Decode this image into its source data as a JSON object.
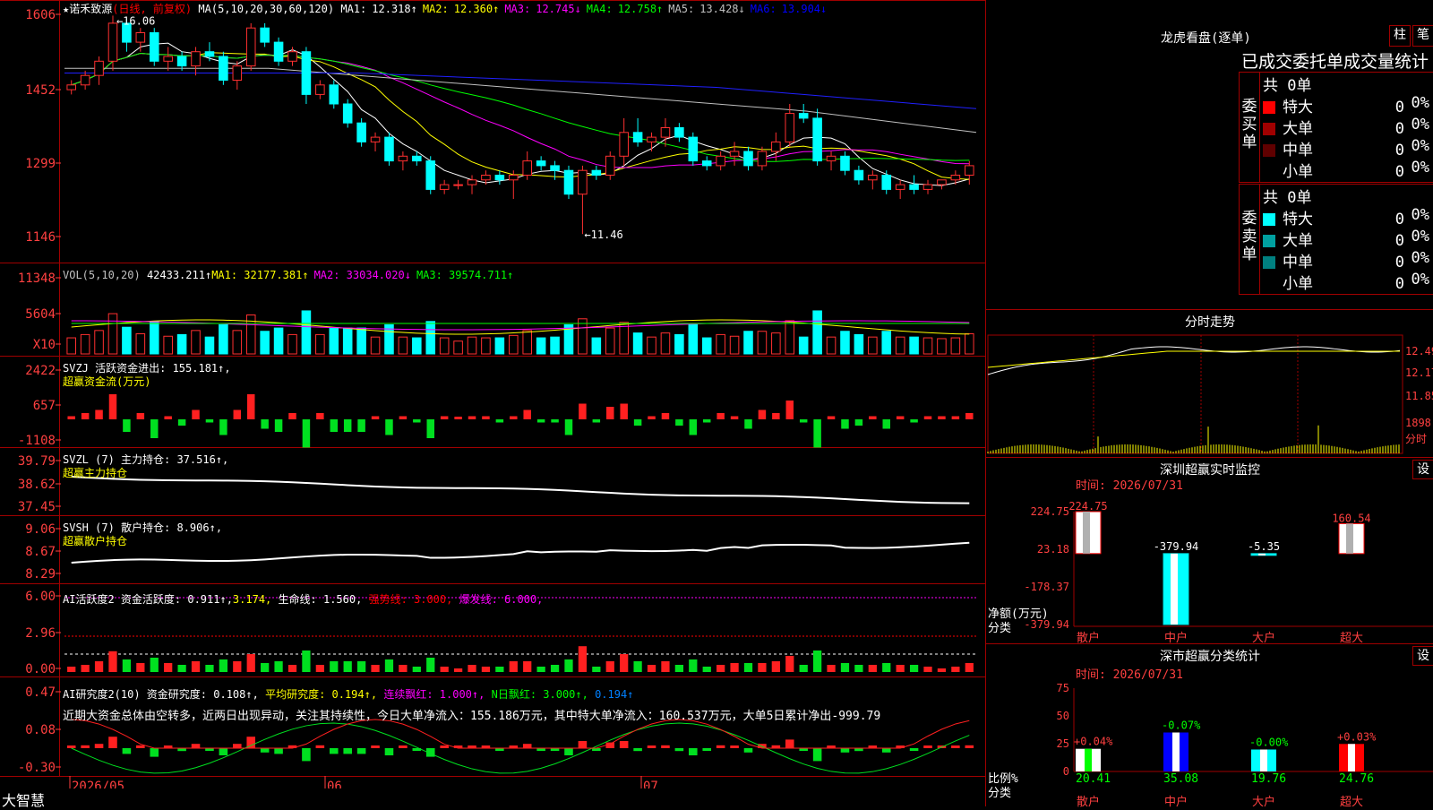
{
  "stock": {
    "star": "★",
    "name": "诺禾致源",
    "mode": "(日线, 前复权)"
  },
  "ma_header": {
    "label": "MA(5,10,20,30,60,120)",
    "items": [
      {
        "name": "MA1:",
        "value": "12.318↑",
        "color": "#ffffff"
      },
      {
        "name": "MA2:",
        "value": "12.360↑",
        "color": "#ffff00"
      },
      {
        "name": "MA3:",
        "value": "12.745↓",
        "color": "#ff00ff"
      },
      {
        "name": "MA4:",
        "value": "12.758↑",
        "color": "#00ff00"
      },
      {
        "name": "MA5:",
        "value": "13.428↓",
        "color": "#c0c0c0"
      },
      {
        "name": "MA6:",
        "value": "13.904↓",
        "color": "#0000ff"
      }
    ]
  },
  "vol_header": {
    "label": "VOL(5,10,20)",
    "value": "42433.211↑",
    "items": [
      {
        "text": "MA1: 32177.381↑",
        "color": "#ffff00"
      },
      {
        "text": "MA2: 33034.020↓",
        "color": "#ff00ff"
      },
      {
        "text": "MA3: 39574.711↑",
        "color": "#00ff00"
      }
    ]
  },
  "svzj": {
    "line1": "SVZJ  活跃资金进出: 155.181↑,",
    "line2": "超赢资金流(万元)"
  },
  "svzl": {
    "line1": "SVZL (7) 主力持仓: 37.516↑,",
    "line2": "超赢主力持仓"
  },
  "svsh": {
    "line1": "SVSH (7) 散户持仓: 8.906↑,",
    "line2": "超赢散户持仓"
  },
  "ai1": {
    "label": "AI活跃度2 资金活跃度: 0.911↑,",
    "v2": "3.174,",
    "v3": "生命线: 1.560,",
    "v4": "强势线: 3.000,",
    "v5": "爆发线: 6.000,"
  },
  "ai2": {
    "label": "AI研究度2(10) 资金研究度: 0.108↑,",
    "v2": "平均研究度: 0.194↑,",
    "v3": "连续飘红: 1.000↑,",
    "v4": "N日飘红: 3.000↑,",
    "v5": "0.194↑",
    "comment": "近期大资金总体由空转多，近两日出现异动，关注其持续性，今日大单净流入：155.186万元，其中特大单净流入：160.537万元，大单5日累计净出-999.79"
  },
  "axes": {
    "price": [
      "1606",
      "1452",
      "1299",
      "1146"
    ],
    "vol": [
      "11348",
      "5604",
      "X10"
    ],
    "svzj": [
      "2422",
      "657",
      "-1108"
    ],
    "svzl": [
      "39.79",
      "38.62",
      "37.45"
    ],
    "svsh": [
      "9.06",
      "8.67",
      "8.29"
    ],
    "ai1": [
      "6.00",
      "2.96",
      "0.00"
    ],
    "ai2": [
      "0.47",
      "0.08",
      "-0.30"
    ],
    "dates": [
      "2026/05",
      "06",
      "07"
    ]
  },
  "annotations": {
    "high": "←16.06",
    "low": "←11.46"
  },
  "brand": "大智慧",
  "right": {
    "title": "龙虎看盘(逐单)",
    "btn1": "柱",
    "btn2": "笔",
    "subtitle": "已成交委托单成交量统计",
    "buy": {
      "side": "委买单",
      "total": "共 0单",
      "rows": [
        {
          "label": "特大",
          "count": "0",
          "pct": "0%",
          "color": "#ff0000"
        },
        {
          "label": "大单",
          "count": "0",
          "pct": "0%",
          "color": "#a00000"
        },
        {
          "label": "中单",
          "count": "0",
          "pct": "0%",
          "color": "#600000"
        },
        {
          "label": "小单",
          "count": "0",
          "pct": "0%",
          "color": "#000000"
        }
      ]
    },
    "sell": {
      "side": "委卖单",
      "total": "共 0单",
      "rows": [
        {
          "label": "特大",
          "count": "0",
          "pct": "0%",
          "color": "#00ffff"
        },
        {
          "label": "大单",
          "count": "0",
          "pct": "0%",
          "color": "#00a0a0"
        },
        {
          "label": "中单",
          "count": "0",
          "pct": "0%",
          "color": "#008080"
        },
        {
          "label": "小单",
          "count": "0",
          "pct": "0%",
          "color": "#000000"
        }
      ]
    },
    "intraday": {
      "title": "分时走势",
      "axis": [
        "12.49",
        "12.17",
        "11.85",
        "1898",
        "分时"
      ]
    },
    "monitor": {
      "title": "深圳超赢实时监控",
      "btn": "设",
      "time": "时间: 2026/07/31",
      "yaxis": [
        "224.75",
        "23.18",
        "-178.37",
        "-379.94"
      ],
      "ylabel": "净额(万元)",
      "xlabel": "分类",
      "bars": [
        {
          "cat": "散户",
          "value": 224.75,
          "label": "224.75"
        },
        {
          "cat": "中户",
          "value": -379.94,
          "label": "-379.94"
        },
        {
          "cat": "大户",
          "value": -5.35,
          "label": "-5.35"
        },
        {
          "cat": "超大",
          "value": 160.54,
          "label": "160.54"
        }
      ]
    },
    "stats": {
      "title": "深市超赢分类统计",
      "btn": "设",
      "time": "时间: 2026/07/31",
      "yaxis": [
        "75",
        "50",
        "25",
        "0"
      ],
      "ylabel": "比例%",
      "xlabel": "分类",
      "bars": [
        {
          "cat": "散户",
          "value": 20.41,
          "label": "20.41",
          "delta": "+0.04%"
        },
        {
          "cat": "中户",
          "value": 35.08,
          "label": "35.08",
          "delta": "-0.07%"
        },
        {
          "cat": "大户",
          "value": 19.76,
          "label": "19.76",
          "delta": "-0.00%"
        },
        {
          "cat": "超大",
          "value": 24.76,
          "label": "24.76",
          "delta": "+0.03%"
        }
      ]
    }
  },
  "chart_data": [
    {
      "type": "candlestick",
      "title": "诺禾致源 (日线, 前复权)",
      "ylim": [
        11.46,
        16.06
      ],
      "candles": [
        [
          14.5,
          14.7,
          14.4,
          14.6
        ],
        [
          14.6,
          14.9,
          14.5,
          14.8
        ],
        [
          14.8,
          15.2,
          14.6,
          15.1
        ],
        [
          15.1,
          16.06,
          14.9,
          15.9
        ],
        [
          15.9,
          16.0,
          15.3,
          15.5
        ],
        [
          15.5,
          15.8,
          15.3,
          15.7
        ],
        [
          15.7,
          15.8,
          15.0,
          15.1
        ],
        [
          15.1,
          15.4,
          14.9,
          15.2
        ],
        [
          15.2,
          15.3,
          14.9,
          15.0
        ],
        [
          15.0,
          15.4,
          14.8,
          15.3
        ],
        [
          15.3,
          15.5,
          15.1,
          15.2
        ],
        [
          15.2,
          15.3,
          14.6,
          14.7
        ],
        [
          14.7,
          15.1,
          14.5,
          15.0
        ],
        [
          15.0,
          15.9,
          14.9,
          15.8
        ],
        [
          15.8,
          15.9,
          15.4,
          15.5
        ],
        [
          15.5,
          15.6,
          15.0,
          15.1
        ],
        [
          15.1,
          15.4,
          15.0,
          15.3
        ],
        [
          15.3,
          15.4,
          14.2,
          14.4
        ],
        [
          14.4,
          14.7,
          14.3,
          14.6
        ],
        [
          14.6,
          14.7,
          14.1,
          14.2
        ],
        [
          14.2,
          14.3,
          13.7,
          13.8
        ],
        [
          13.8,
          13.9,
          13.3,
          13.4
        ],
        [
          13.4,
          13.6,
          13.2,
          13.5
        ],
        [
          13.5,
          13.6,
          12.9,
          13.0
        ],
        [
          13.0,
          13.2,
          12.8,
          13.1
        ],
        [
          13.1,
          13.2,
          12.9,
          13.0
        ],
        [
          13.0,
          13.1,
          12.3,
          12.4
        ],
        [
          12.4,
          12.6,
          12.3,
          12.5
        ],
        [
          12.5,
          12.6,
          12.4,
          12.5
        ],
        [
          12.5,
          12.7,
          12.3,
          12.6
        ],
        [
          12.6,
          12.8,
          12.5,
          12.7
        ],
        [
          12.7,
          12.8,
          12.5,
          12.6
        ],
        [
          12.6,
          12.8,
          12.2,
          12.7
        ],
        [
          12.7,
          13.2,
          12.6,
          13.0
        ],
        [
          13.0,
          13.1,
          12.8,
          12.9
        ],
        [
          12.9,
          13.0,
          12.6,
          12.8
        ],
        [
          12.8,
          12.9,
          12.2,
          12.3
        ],
        [
          12.3,
          12.9,
          11.46,
          12.8
        ],
        [
          12.8,
          12.9,
          12.6,
          12.7
        ],
        [
          12.7,
          13.2,
          12.6,
          13.1
        ],
        [
          13.1,
          13.9,
          12.9,
          13.6
        ],
        [
          13.6,
          13.9,
          13.3,
          13.4
        ],
        [
          13.4,
          13.6,
          13.2,
          13.5
        ],
        [
          13.5,
          13.9,
          13.3,
          13.7
        ],
        [
          13.7,
          13.8,
          13.4,
          13.5
        ],
        [
          13.5,
          13.6,
          12.9,
          13.0
        ],
        [
          13.0,
          13.1,
          12.8,
          12.9
        ],
        [
          12.9,
          13.2,
          12.8,
          13.1
        ],
        [
          13.1,
          13.4,
          12.9,
          13.2
        ],
        [
          13.2,
          13.3,
          12.8,
          12.9
        ],
        [
          12.9,
          13.3,
          12.8,
          13.2
        ],
        [
          13.2,
          13.6,
          13.0,
          13.4
        ],
        [
          13.4,
          14.2,
          13.3,
          14.0
        ],
        [
          14.0,
          14.2,
          13.8,
          13.9
        ],
        [
          13.9,
          14.1,
          12.9,
          13.0
        ],
        [
          13.0,
          13.2,
          12.8,
          13.1
        ],
        [
          13.1,
          13.2,
          12.7,
          12.8
        ],
        [
          12.8,
          12.9,
          12.5,
          12.6
        ],
        [
          12.6,
          12.8,
          12.4,
          12.7
        ],
        [
          12.7,
          12.8,
          12.3,
          12.4
        ],
        [
          12.4,
          12.6,
          12.2,
          12.5
        ],
        [
          12.5,
          12.7,
          12.3,
          12.4
        ],
        [
          12.4,
          12.6,
          12.3,
          12.5
        ],
        [
          12.5,
          12.6,
          12.4,
          12.6
        ],
        [
          12.6,
          12.8,
          12.5,
          12.7
        ],
        [
          12.7,
          13.0,
          12.5,
          12.9
        ]
      ]
    }
  ]
}
